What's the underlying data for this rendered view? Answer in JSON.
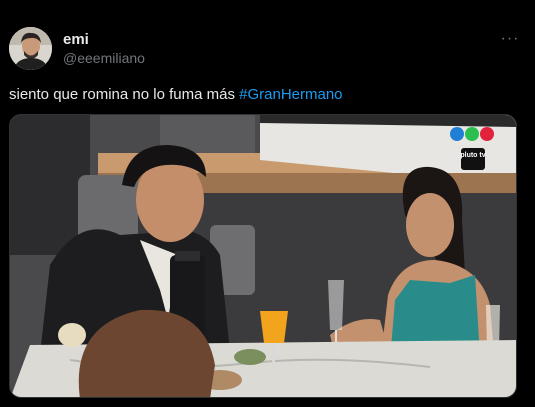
{
  "author": {
    "display_name": "emi",
    "handle": "@eeemiliano",
    "avatar_icon": "profile-photo-icon"
  },
  "tweet": {
    "text_prefix": "siento que romina no lo fuma más ",
    "hashtag": "#GranHermano",
    "more_label": "···"
  },
  "media": {
    "watermark_text": "pluto tv",
    "broadcaster_logo": "telefe-dots-logo",
    "colors": {
      "dot_blue": "#1f7fd6",
      "dot_green": "#2bbf4f",
      "dot_red": "#e0233b"
    }
  }
}
